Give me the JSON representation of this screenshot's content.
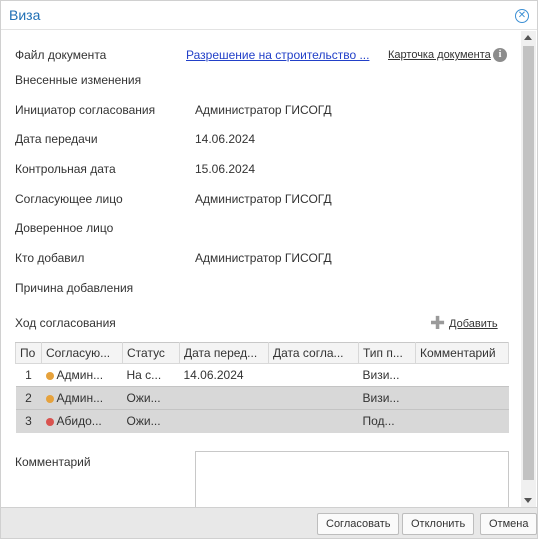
{
  "dialog": {
    "title": "Виза",
    "close_icon": "close-circle-icon"
  },
  "fields": {
    "doc_file_label": "Файл документа",
    "doc_file_link": "Разрешение на строительство ...",
    "card_link": "Карточка документа",
    "changes_label": "Внесенные изменения",
    "initiator_label": "Инициатор согласования",
    "initiator_value": "Администратор ГИСОГД",
    "transfer_date_label": "Дата передачи",
    "transfer_date_value": "14.06.2024",
    "control_date_label": "Контрольная дата",
    "control_date_value": "15.06.2024",
    "approver_label": "Согласующее лицо",
    "approver_value": "Администратор ГИСОГД",
    "trusted_label": "Доверенное лицо",
    "added_by_label": "Кто добавил",
    "added_by_value": "Администратор ГИСОГД",
    "add_reason_label": "Причина добавления"
  },
  "progress": {
    "title": "Ход согласования",
    "add_label": "Добавить",
    "columns": [
      "По",
      "Согласую...",
      "Статус",
      "Дата перед...",
      "Дата согла...",
      "Тип п...",
      "Комментарий"
    ],
    "rows": [
      {
        "num": "1",
        "name": "Админ...",
        "status": "На с...",
        "transfer_date": "14.06.2024",
        "approve_date": "",
        "type": "Визи...",
        "comment": "",
        "icon_color": "#e6a23c"
      },
      {
        "num": "2",
        "name": "Админ...",
        "status": "Ожи...",
        "transfer_date": "",
        "approve_date": "",
        "type": "Визи...",
        "comment": "",
        "icon_color": "#e6a23c"
      },
      {
        "num": "3",
        "name": "Абидо...",
        "status": "Ожи...",
        "transfer_date": "",
        "approve_date": "",
        "type": "Под...",
        "comment": "",
        "icon_color": "#d9534f"
      }
    ]
  },
  "comment": {
    "label": "Комментарий",
    "value": ""
  },
  "buttons": {
    "approve": "Согласовать",
    "reject": "Отклонить",
    "cancel": "Отмена"
  },
  "colors": {
    "title": "#1f6fb5",
    "link": "#2240c8",
    "selected_row": "#d8d8d8"
  }
}
